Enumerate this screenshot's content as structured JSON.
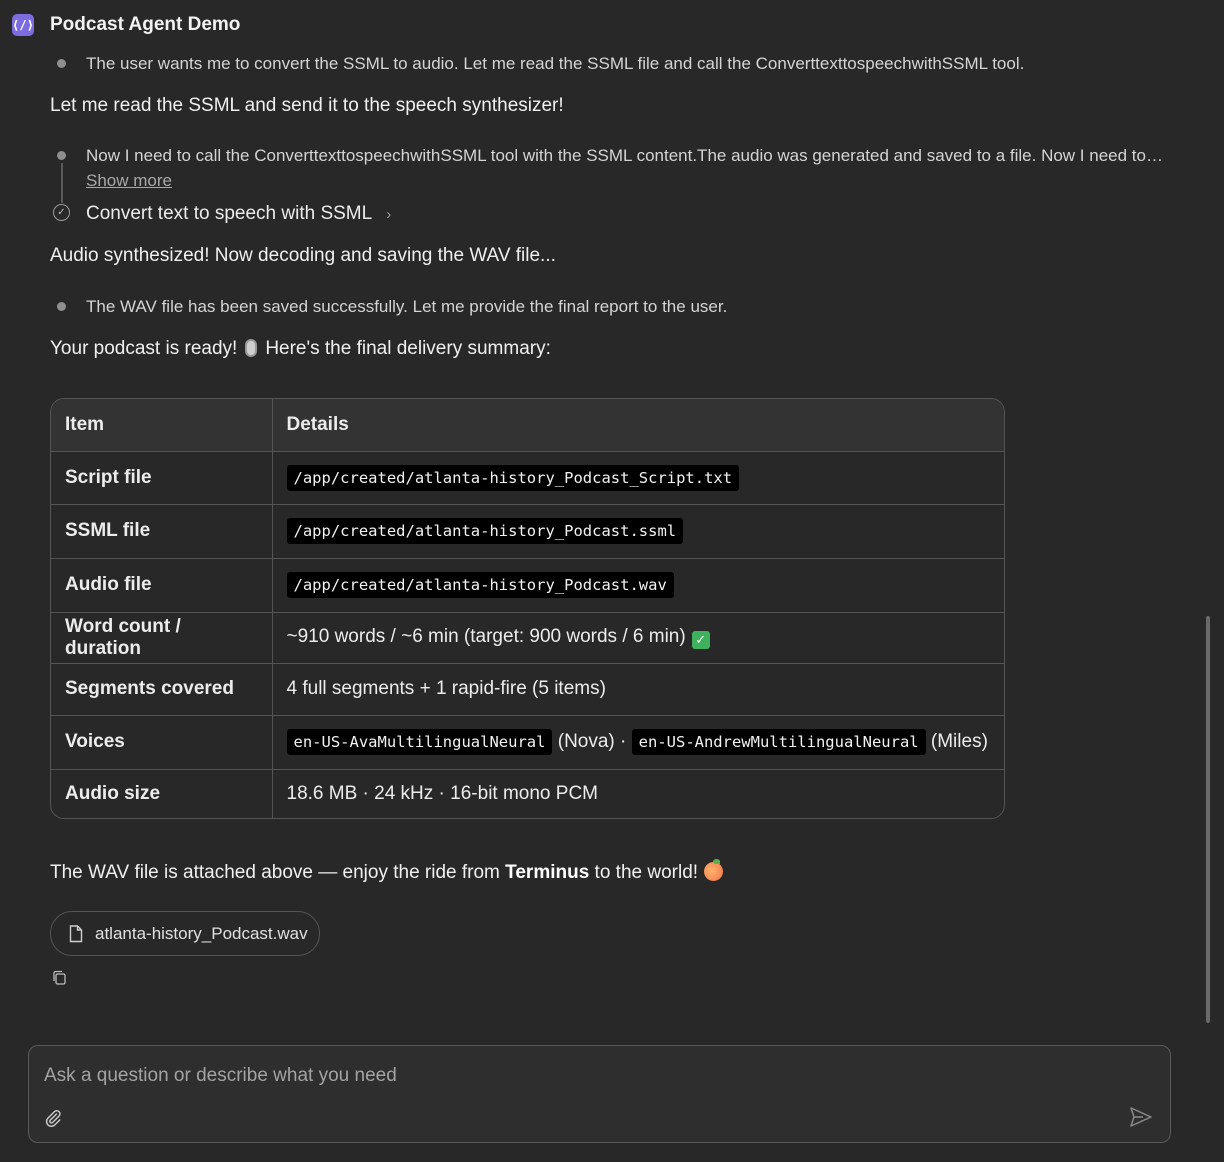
{
  "header": {
    "agent_name": "Podcast Agent Demo",
    "avatar_glyph": "⟨/⟩"
  },
  "thoughts": {
    "t1": "The user wants me to convert the SSML to audio. Let me read the SSML file and call the ConverttexttospeechwithSSML tool.",
    "t2": "Now I need to call the ConverttexttospeechwithSSML tool with the SSML content.The audio was generated and saved to a file. Now I need to…",
    "t2_show_more": "Show more",
    "t3": "The WAV file has been saved successfully. Let me provide the final report to the user."
  },
  "tool_call": {
    "label": "Convert text to speech with SSML"
  },
  "messages": {
    "m1": "Let me read the SSML and send it to the speech synthesizer!",
    "m2": "Audio synthesized! Now decoding and saving the WAV file...",
    "m3_before": "Your podcast is ready!",
    "m3_after": "Here's the final delivery summary:",
    "m4_before": "The WAV file is attached above — enjoy the ride from ",
    "m4_bold": "Terminus",
    "m4_after": " to the world!"
  },
  "table": {
    "headers": [
      "Item",
      "Details"
    ],
    "rows": {
      "script": {
        "label": "Script file",
        "value": "/app/created/atlanta-history_Podcast_Script.txt"
      },
      "ssml": {
        "label": "SSML file",
        "value": "/app/created/atlanta-history_Podcast.ssml"
      },
      "audio": {
        "label": "Audio file",
        "value": "/app/created/atlanta-history_Podcast.wav"
      },
      "words": {
        "label": "Word count / duration",
        "value": "~910 words / ~6 min (target: 900 words / 6 min)"
      },
      "segments": {
        "label": "Segments covered",
        "value": "4 full segments + 1 rapid-fire (5 items)"
      },
      "voices": {
        "label": "Voices",
        "voice1": "en-US-AvaMultilingualNeural",
        "voice1_name": "(Nova) ·",
        "voice2": "en-US-AndrewMultilingualNeural",
        "voice2_name": "(Miles)"
      },
      "size": {
        "label": "Audio size",
        "value": "18.6 MB · 24 kHz · 16-bit mono PCM"
      }
    }
  },
  "attachment": {
    "filename": "atlanta-history_Podcast.wav"
  },
  "composer": {
    "placeholder": "Ask a question or describe what you need"
  },
  "icons": {
    "agent": "code-brackets-icon",
    "thought": "dot-icon",
    "tool_status": "check-circle-icon",
    "tool_expand": "chevron-right-icon",
    "mic": "microphone-icon",
    "check": "check-mark-icon",
    "peach": "peach-icon",
    "file": "file-icon",
    "copy": "copy-icon",
    "attach": "paperclip-icon",
    "send": "send-icon"
  },
  "colors": {
    "accent": "#7c6ce0",
    "background": "#282828",
    "code_bg": "#000000",
    "check": "#3fb15c"
  }
}
